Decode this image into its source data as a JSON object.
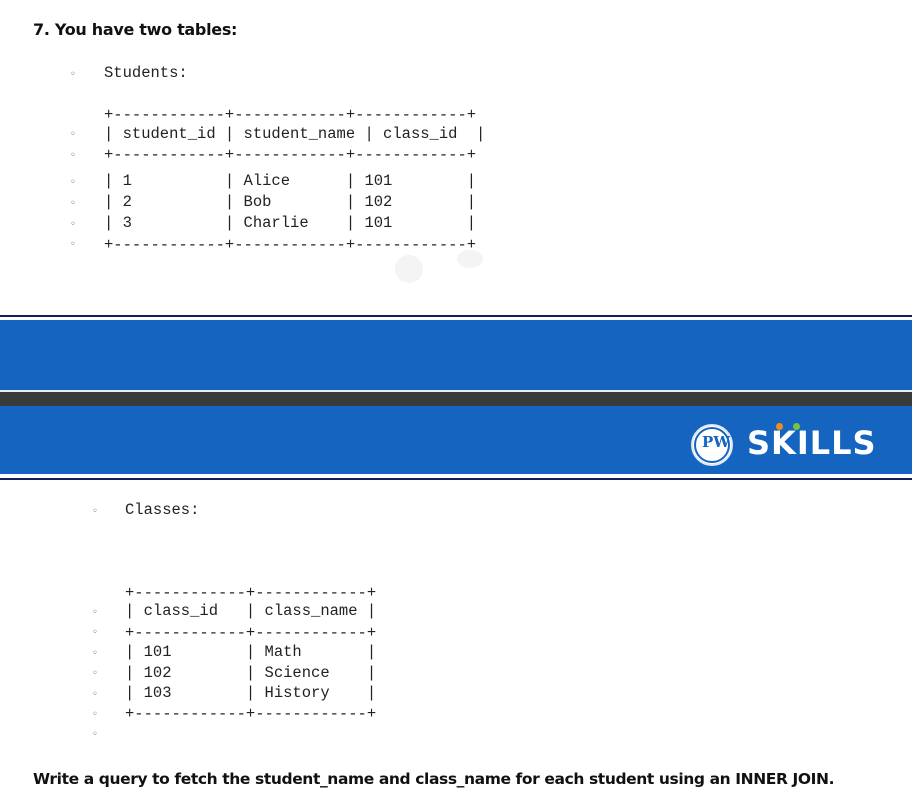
{
  "heading": "7. You have two tables:",
  "students": {
    "label": "Students:",
    "lines": [
      "+------------+------------+------------+",
      "| student_id | student_name | class_id  |",
      "+------------+------------+------------+",
      "| 1          | Alice      | 101        |",
      "| 2          | Bob        | 102        |",
      "| 3          | Charlie    | 101        |",
      "+------------+------------+------------+"
    ]
  },
  "banner": {
    "brand": "SKILLS",
    "logo_mark": "PW",
    "colors": {
      "blue": "#1565c0",
      "dark": "#3a3a3a",
      "orange": "#f28b1e",
      "green": "#7cc242"
    }
  },
  "classes": {
    "label": "Classes:",
    "lines": [
      "+------------+------------+",
      "| class_id   | class_name |",
      "+------------+------------+",
      "| 101        | Math       |",
      "| 102        | Science    |",
      "| 103        | History    |",
      "+------------+------------+"
    ]
  },
  "bullet_glyph": "◦",
  "question": "Write a query to fetch the student_name and class_name for each student using an INNER JOIN."
}
